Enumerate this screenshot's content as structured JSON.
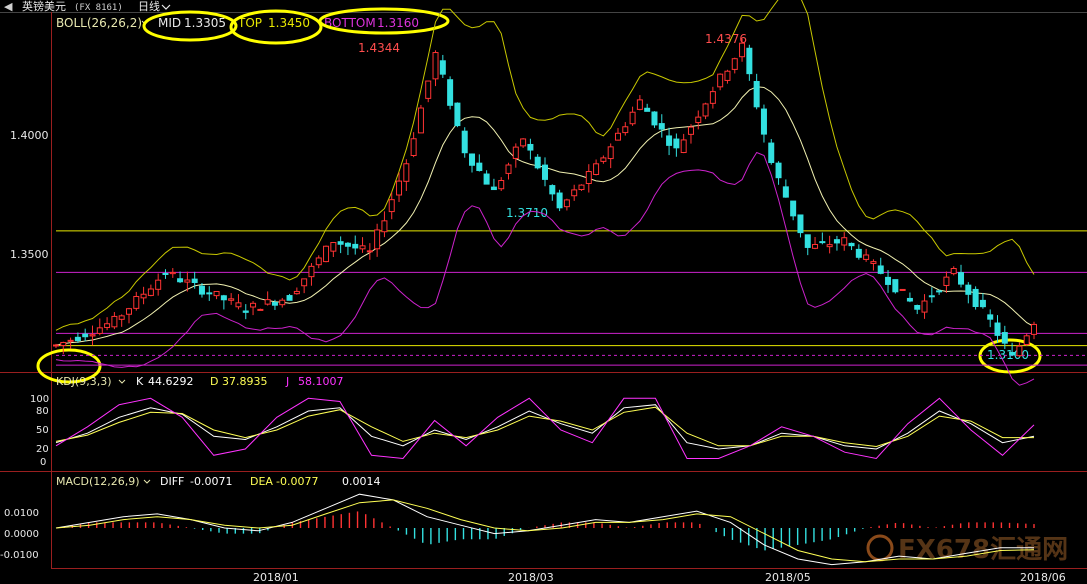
{
  "header": {
    "symbol": "英镑美元",
    "code": "(FX 8161)",
    "period": "日线",
    "period_arrow": "chevron-down"
  },
  "boll_legend": {
    "name": "BOLL(26,26,2)",
    "mid_label": "MID",
    "mid_value": "1.3305",
    "top_label": "TOP",
    "top_value": "1.3450",
    "bottom_label": "BOTTOM",
    "bottom_value": "1.3160"
  },
  "kdj_legend": {
    "name": "KDJ(9,3,3)",
    "k_label": "K",
    "k_value": "44.6292",
    "d_label": "D",
    "d_value": "37.8935",
    "j_label": "J",
    "j_value": "58.1007"
  },
  "macd_legend": {
    "name": "MACD(12,26,9)",
    "diff_label": "DIFF",
    "diff_value": "-0.0071",
    "dea_label": "DEA",
    "dea_value": "-0.0077",
    "macd_value": "0.0014"
  },
  "annotations": {
    "high1": "1.4344",
    "high2": "1.4376",
    "low1": "1.3710",
    "low2": "1.3100",
    "watermark": "FX678汇通网"
  },
  "colors": {
    "up": "#ff3333",
    "down": "#33e0e0",
    "mid": "#f0f0b0",
    "band": "#c8c800",
    "bottom": "#cc22cc",
    "highlight": "#ffff00",
    "kline": "#ffffff",
    "dline": "#ffff55",
    "jline": "#ff33ff"
  },
  "chart_data": [
    {
      "type": "candlestick",
      "title": "英镑美元 (FX 8161) 日线",
      "indicator": "BOLL(26,26,2)",
      "x_ticks": [
        "2018/01",
        "2018/03",
        "2018/05",
        "2018/06"
      ],
      "y_ticks": [
        "1.4000",
        "1.3500"
      ],
      "ylim": [
        1.305,
        1.45
      ],
      "price_path": [
        [
          0,
          1.315
        ],
        [
          8,
          1.325
        ],
        [
          15,
          1.345
        ],
        [
          20,
          1.338
        ],
        [
          26,
          1.33
        ],
        [
          32,
          1.335
        ],
        [
          38,
          1.358
        ],
        [
          43,
          1.353
        ],
        [
          48,
          1.39
        ],
        [
          52,
          1.4344
        ],
        [
          56,
          1.395
        ],
        [
          60,
          1.378
        ],
        [
          64,
          1.4
        ],
        [
          69,
          1.371
        ],
        [
          74,
          1.388
        ],
        [
          80,
          1.415
        ],
        [
          85,
          1.395
        ],
        [
          90,
          1.42
        ],
        [
          94,
          1.4376
        ],
        [
          98,
          1.39
        ],
        [
          103,
          1.355
        ],
        [
          108,
          1.358
        ],
        [
          113,
          1.345
        ],
        [
          118,
          1.33
        ],
        [
          123,
          1.345
        ],
        [
          128,
          1.325
        ],
        [
          131,
          1.31
        ],
        [
          134,
          1.325
        ]
      ],
      "horizontal_levels": [
        {
          "value": 1.362,
          "color": "#e8e800"
        },
        {
          "value": 1.345,
          "color": "#cc22cc"
        },
        {
          "value": 1.32,
          "color": "#cc22cc"
        },
        {
          "value": 1.315,
          "color": "#e8e800"
        },
        {
          "value": 1.311,
          "color": "#cc22cc",
          "dashed": true
        },
        {
          "value": 1.307,
          "color": "#cc22cc"
        }
      ]
    },
    {
      "type": "line",
      "indicator": "KDJ(9,3,3)",
      "y_ticks": [
        "100",
        "80",
        "50",
        "20",
        "0"
      ],
      "ylim": [
        -10,
        110
      ],
      "series": [
        {
          "name": "K",
          "values": [
            30,
            45,
            70,
            85,
            75,
            40,
            35,
            55,
            80,
            85,
            40,
            25,
            50,
            35,
            55,
            80,
            60,
            45,
            85,
            90,
            30,
            20,
            25,
            45,
            40,
            25,
            20,
            45,
            80,
            60,
            30,
            40
          ]
        },
        {
          "name": "D",
          "values": [
            32,
            42,
            62,
            78,
            76,
            50,
            38,
            50,
            72,
            82,
            55,
            32,
            45,
            38,
            50,
            72,
            64,
            50,
            78,
            86,
            45,
            25,
            25,
            40,
            40,
            30,
            24,
            40,
            72,
            64,
            38,
            38
          ]
        },
        {
          "name": "J",
          "values": [
            25,
            55,
            90,
            100,
            70,
            10,
            20,
            70,
            100,
            95,
            10,
            5,
            65,
            25,
            70,
            100,
            50,
            30,
            100,
            100,
            5,
            5,
            25,
            55,
            40,
            15,
            5,
            60,
            100,
            50,
            10,
            58
          ]
        }
      ]
    },
    {
      "type": "bar",
      "indicator": "MACD(12,26,9)",
      "y_ticks": [
        "0.0100",
        "0.0000",
        "-0.0100"
      ],
      "ylim": [
        -0.0135,
        0.0135
      ],
      "series": [
        {
          "name": "DIFF",
          "values": [
            0.0,
            0.002,
            0.004,
            0.005,
            0.003,
            0.0,
            -0.001,
            0.002,
            0.007,
            0.012,
            0.01,
            0.004,
            0.001,
            -0.002,
            -0.001,
            0.001,
            0.003,
            0.002,
            0.004,
            0.006,
            0.002,
            -0.006,
            -0.011,
            -0.013,
            -0.012,
            -0.01,
            -0.011,
            -0.009,
            -0.007,
            -0.007
          ]
        },
        {
          "name": "DEA",
          "values": [
            0.0,
            0.001,
            0.003,
            0.004,
            0.003,
            0.001,
            0.0,
            0.001,
            0.005,
            0.009,
            0.01,
            0.007,
            0.003,
            0.0,
            -0.001,
            0.0,
            0.002,
            0.002,
            0.003,
            0.005,
            0.004,
            -0.002,
            -0.008,
            -0.011,
            -0.012,
            -0.011,
            -0.011,
            -0.01,
            -0.008,
            -0.0077
          ]
        }
      ]
    }
  ]
}
